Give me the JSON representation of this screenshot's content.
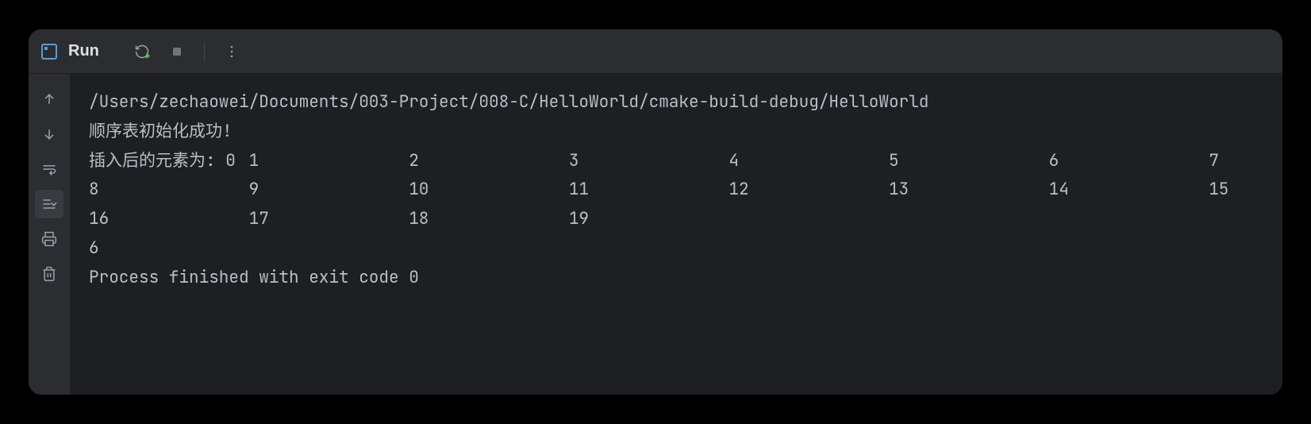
{
  "toolbar": {
    "title": "Run"
  },
  "console": {
    "path": "/Users/zechaowei/Documents/003-Project/008-C/HelloWorld/cmake-build-debug/HelloWorld",
    "line_init": "顺序表初始化成功!",
    "line_inserted": "插入后的元素为: 0\t1\t\t2\t\t3\t\t4\t\t5\t\t6\t\t7\t\t8\t\t9\t\t10\t\t11\t\t12\t\t13\t\t14\t\t15\t\t16\t\t17\t\t18\t\t19\t\t",
    "line_result": "6",
    "line_exit": "Process finished with exit code 0"
  }
}
